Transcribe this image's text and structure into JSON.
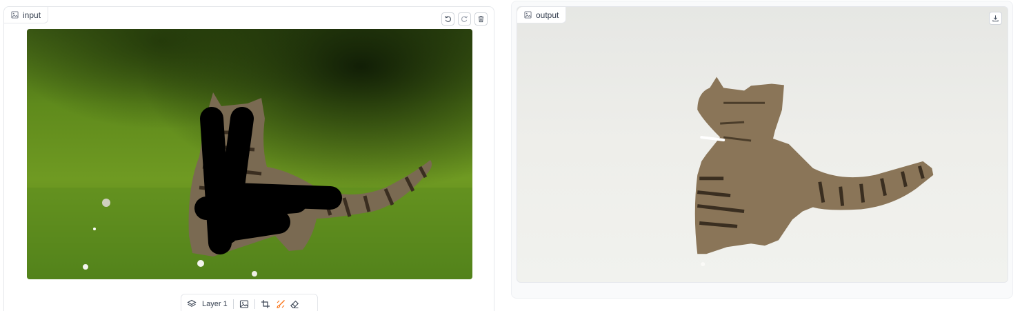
{
  "input_panel": {
    "label": "input",
    "label_icon": "image-icon",
    "actions": [
      {
        "name": "undo-button",
        "icon": "undo-icon"
      },
      {
        "name": "redo-button",
        "icon": "redo-icon"
      },
      {
        "name": "clear-button",
        "icon": "trash-icon"
      }
    ],
    "toolbar": {
      "layer_label": "Layer 1",
      "tools": [
        "layers-icon",
        "image-upload-icon",
        "crop-icon",
        "brush-icon",
        "eraser-icon"
      ],
      "active_tool": "brush-icon",
      "accent_color": "#f97316"
    }
  },
  "output_panel": {
    "label": "output",
    "label_icon": "image-icon",
    "actions": [
      {
        "name": "download-button",
        "icon": "download-icon"
      }
    ]
  }
}
